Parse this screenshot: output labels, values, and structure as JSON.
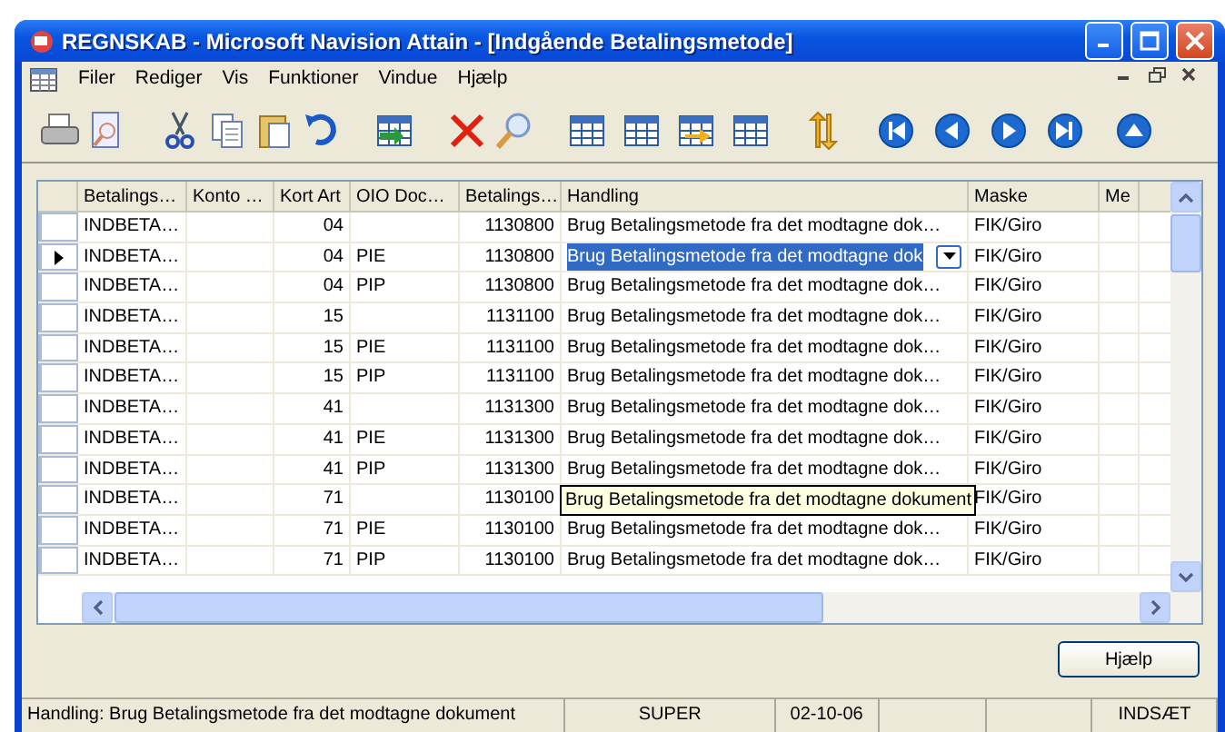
{
  "window": {
    "title": "REGNSKAB - Microsoft Navision Attain - [Indgående Betalingsmetode]"
  },
  "menu": [
    "Filer",
    "Rediger",
    "Vis",
    "Funktioner",
    "Vindue",
    "Hjælp"
  ],
  "table": {
    "columns": [
      "Betalings…",
      "Konto …",
      "Kort Art",
      "OIO Doc…",
      "Betalings…",
      "Handling",
      "Maske",
      "Me"
    ],
    "rows": [
      {
        "selected": false,
        "betalingsmetode": "INDBETA…",
        "kort_art": "04",
        "betalingskode": "1130800",
        "handling": "Brug Betalingsmetode fra det modtagne dok…",
        "maske": "FIK/Giro"
      },
      {
        "selected": true,
        "betalingsmetode": "INDBETA…",
        "kort_art": "04",
        "oio_doc": "PIE",
        "betalingskode": "1130800",
        "handling": "Brug Betalingsmetode fra det modtagne dok",
        "maske": "FIK/Giro"
      },
      {
        "selected": false,
        "betalingsmetode": "INDBETA…",
        "kort_art": "04",
        "oio_doc": "PIP",
        "betalingskode": "1130800",
        "handling": "Brug Betalingsmetode fra det modtagne dok…",
        "maske": "FIK/Giro"
      },
      {
        "selected": false,
        "betalingsmetode": "INDBETA…",
        "kort_art": "15",
        "betalingskode": "1131100",
        "handling": "Brug Betalingsmetode fra det modtagne dok…",
        "maske": "FIK/Giro"
      },
      {
        "selected": false,
        "betalingsmetode": "INDBETA…",
        "kort_art": "15",
        "oio_doc": "PIE",
        "betalingskode": "1131100",
        "handling": "Brug Betalingsmetode fra det modtagne dok…",
        "maske": "FIK/Giro"
      },
      {
        "selected": false,
        "betalingsmetode": "INDBETA…",
        "kort_art": "15",
        "oio_doc": "PIP",
        "betalingskode": "1131100",
        "handling": "Brug Betalingsmetode fra det modtagne dok…",
        "maske": "FIK/Giro"
      },
      {
        "selected": false,
        "betalingsmetode": "INDBETA…",
        "kort_art": "41",
        "betalingskode": "1131300",
        "handling": "Brug Betalingsmetode fra det modtagne dok…",
        "maske": "FIK/Giro"
      },
      {
        "selected": false,
        "betalingsmetode": "INDBETA…",
        "kort_art": "41",
        "oio_doc": "PIE",
        "betalingskode": "1131300",
        "handling": "Brug Betalingsmetode fra det modtagne dok…",
        "maske": "FIK/Giro"
      },
      {
        "selected": false,
        "betalingsmetode": "INDBETA…",
        "kort_art": "41",
        "oio_doc": "PIP",
        "betalingskode": "1131300",
        "handling": "Brug Betalingsmetode fra det modtagne dok…",
        "maske": "FIK/Giro"
      },
      {
        "selected": false,
        "betalingsmetode": "INDBETA…",
        "kort_art": "71",
        "betalingskode": "1130100",
        "tooltip": "Brug Betalingsmetode fra det modtagne dokument",
        "maske": "FIK/Giro"
      },
      {
        "selected": false,
        "betalingsmetode": "INDBETA…",
        "kort_art": "71",
        "oio_doc": "PIE",
        "betalingskode": "1130100",
        "handling": "Brug Betalingsmetode fra det modtagne dok…",
        "maske": "FIK/Giro"
      },
      {
        "selected": false,
        "betalingsmetode": "INDBETA…",
        "kort_art": "71",
        "oio_doc": "PIP",
        "betalingskode": "1130100",
        "handling": "Brug Betalingsmetode fra det modtagne dok…",
        "maske": "FIK/Giro"
      }
    ]
  },
  "help_button": "Hjælp",
  "status_bar": {
    "message": "Handling: Brug Betalingsmetode fra det modtagne dokument",
    "user": "SUPER",
    "date": "02-10-06",
    "mode": "INDSÆT"
  }
}
